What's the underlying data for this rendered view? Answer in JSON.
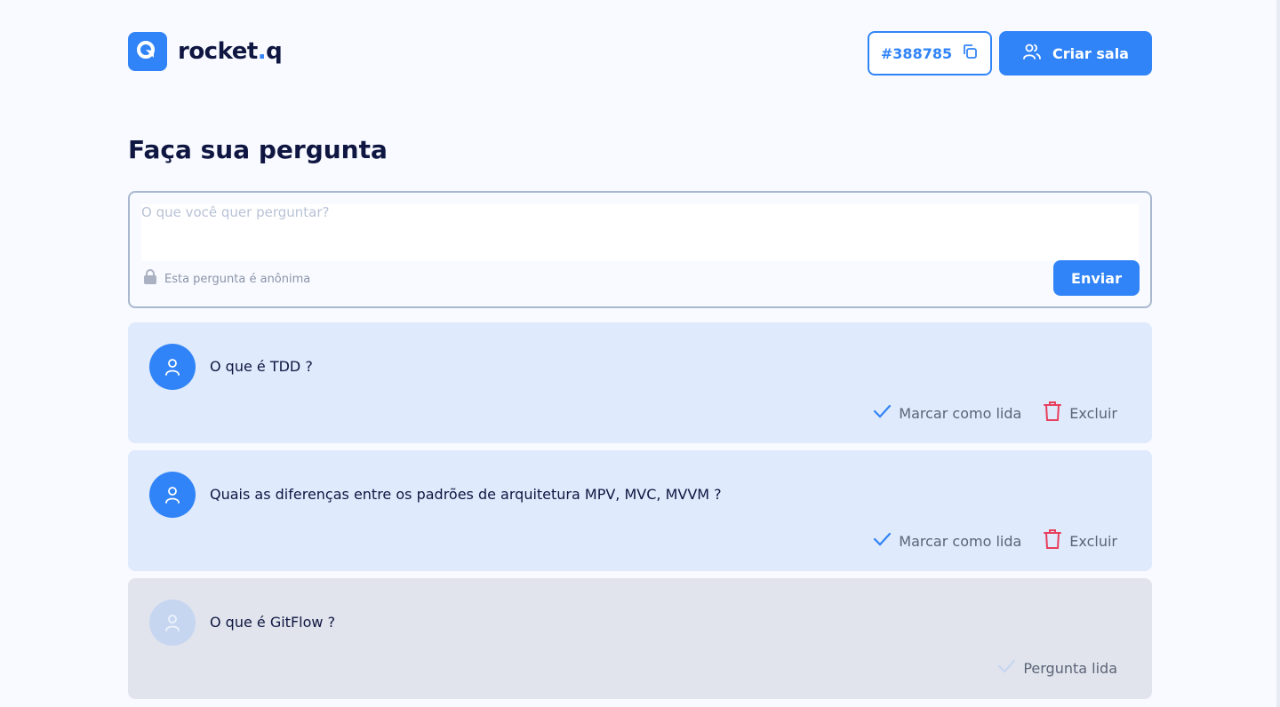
{
  "header": {
    "logo_text": "rocket",
    "logo_dot": ".",
    "logo_suffix": "q",
    "room_code": "#388785",
    "create_room_label": "Criar sala"
  },
  "page_title": "Faça sua pergunta",
  "form": {
    "placeholder": "O que você quer perguntar?",
    "anonymous_note": "Esta pergunta é anônima",
    "send_label": "Enviar"
  },
  "questions": [
    {
      "text": "O que é TDD ?",
      "read": false,
      "mark_read_label": "Marcar como lida",
      "delete_label": "Excluir"
    },
    {
      "text": "Quais as diferenças entre os padrões de arquitetura MPV, MVC, MVVM ?",
      "read": false,
      "mark_read_label": "Marcar como lida",
      "delete_label": "Excluir"
    },
    {
      "text": "O que é GitFlow ?",
      "read": true,
      "read_label": "Pergunta lida"
    }
  ],
  "colors": {
    "primary": "#3184f7",
    "danger": "#e73f5d",
    "unread_bg": "#dfeafc",
    "read_bg": "#e1e4ec"
  }
}
